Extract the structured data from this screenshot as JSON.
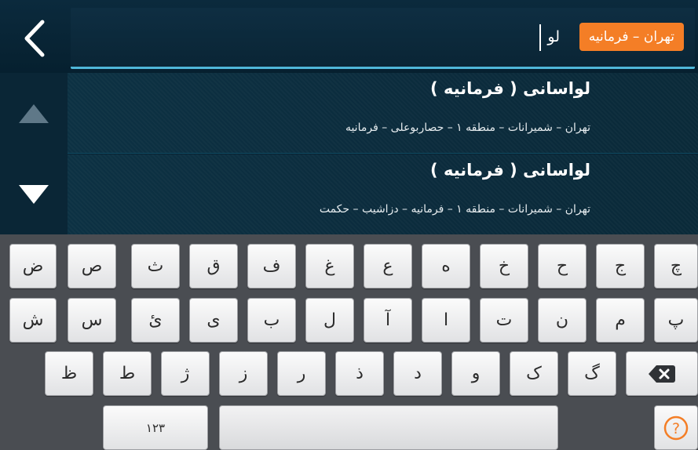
{
  "search": {
    "region_chip": "تهران – فرمانیه",
    "query": "لو"
  },
  "results": [
    {
      "title": "لواسانی ( فرمانیه )",
      "subtitle": "تهران – شمیرانات – منطقه ۱ – حصاربوعلی – فرمانیه"
    },
    {
      "title": "لواسانی ( فرمانیه )",
      "subtitle": "تهران – شمیرانات – منطقه ۱ – فرمانیه – دزاشیب – حکمت"
    }
  ],
  "keyboard": {
    "row1": [
      "ض",
      "ص",
      "ث",
      "ق",
      "ف",
      "غ",
      "ع",
      "ه",
      "خ",
      "ح",
      "ج",
      "چ"
    ],
    "row2": [
      "ش",
      "س",
      "ئ",
      "ی",
      "ب",
      "ل",
      "آ",
      "ا",
      "ت",
      "ن",
      "م",
      "پ"
    ],
    "row3": [
      "ظ",
      "ط",
      "ژ",
      "ز",
      "ر",
      "ذ",
      "د",
      "و",
      "ک",
      "گ"
    ],
    "numbers_label": "۱۲۳",
    "help_glyph": "?"
  },
  "colors": {
    "accent": "#f47e26",
    "divider": "#4fb7d8",
    "panel": "#082232"
  }
}
